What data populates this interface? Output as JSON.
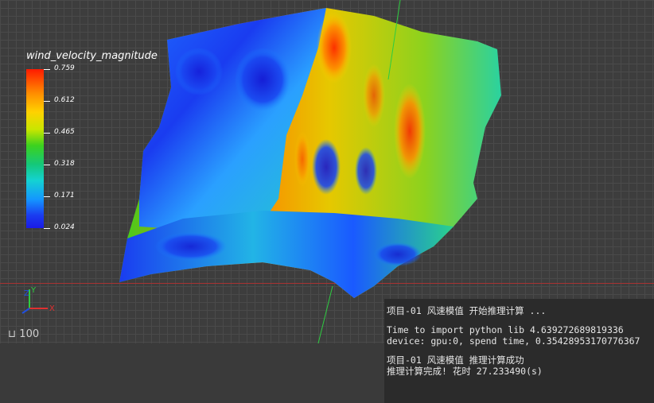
{
  "legend": {
    "title": "wind_velocity_magnitude",
    "ticks": [
      "0.759",
      "0.612",
      "0.465",
      "0.318",
      "0.171",
      "0.024"
    ],
    "colors": [
      "#ff1a00",
      "#ff8c00",
      "#ffd200",
      "#3cd21e",
      "#14d2d2",
      "#1496ff",
      "#1a1ae6"
    ]
  },
  "axes": {
    "x_label": "X",
    "y_label": "Y",
    "z_label": "Z"
  },
  "zoom": {
    "value": "100"
  },
  "console": {
    "line1": "项目-01 风速模值 开始推理计算 ...",
    "line2": "Time to import python lib 4.639272689819336",
    "line3": "device: gpu:0, spend time, 0.35428953170776367",
    "line4": "项目-01 风速模值 推理计算成功",
    "line5": "推理计算完成! 花时 27.233490(s)"
  }
}
